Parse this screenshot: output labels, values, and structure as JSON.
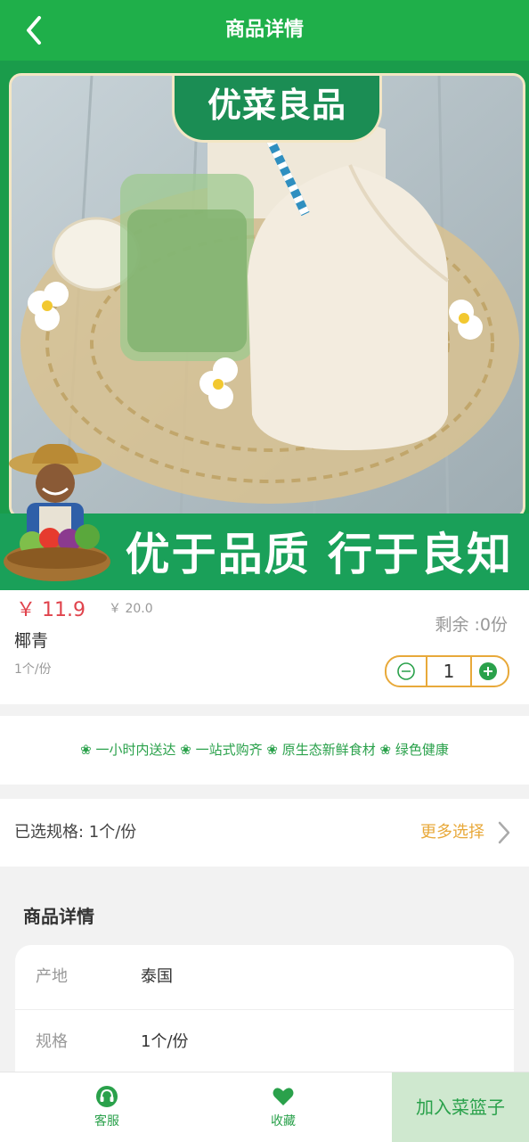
{
  "header": {
    "title": "商品详情"
  },
  "banner": {
    "brand_logo_text": "优菜良品",
    "slogan": "优于品质 行于良知"
  },
  "product": {
    "price": "￥ 11.9",
    "original_price": "￥ 20.0",
    "name": "椰青",
    "unit": "1个/份",
    "stock": "剩余 :0份",
    "quantity": "1"
  },
  "features": {
    "text": "❀ 一小时内送达 ❀ 一站式购齐 ❀ 原生态新鲜食材 ❀ 绿色健康"
  },
  "spec": {
    "selected_label": "已选规格: 1个/份",
    "more_label": "更多选择"
  },
  "detail": {
    "title": "商品详情",
    "rows": [
      {
        "key": "产地",
        "value": "泰国"
      },
      {
        "key": "规格",
        "value": "1个/份"
      }
    ]
  },
  "bottom_bar": {
    "service_label": "客服",
    "favorite_label": "收藏",
    "add_to_cart_label": "加入菜篮子"
  },
  "colors": {
    "brand_green": "#1faf4a",
    "price_red": "#e0434c",
    "accent_orange": "#e8a93a",
    "add_cart_bg": "#cfe8cf"
  },
  "icons": [
    "back-arrow-icon",
    "minus-icon",
    "plus-icon",
    "chevron-right-icon",
    "headset-icon",
    "heart-icon"
  ]
}
